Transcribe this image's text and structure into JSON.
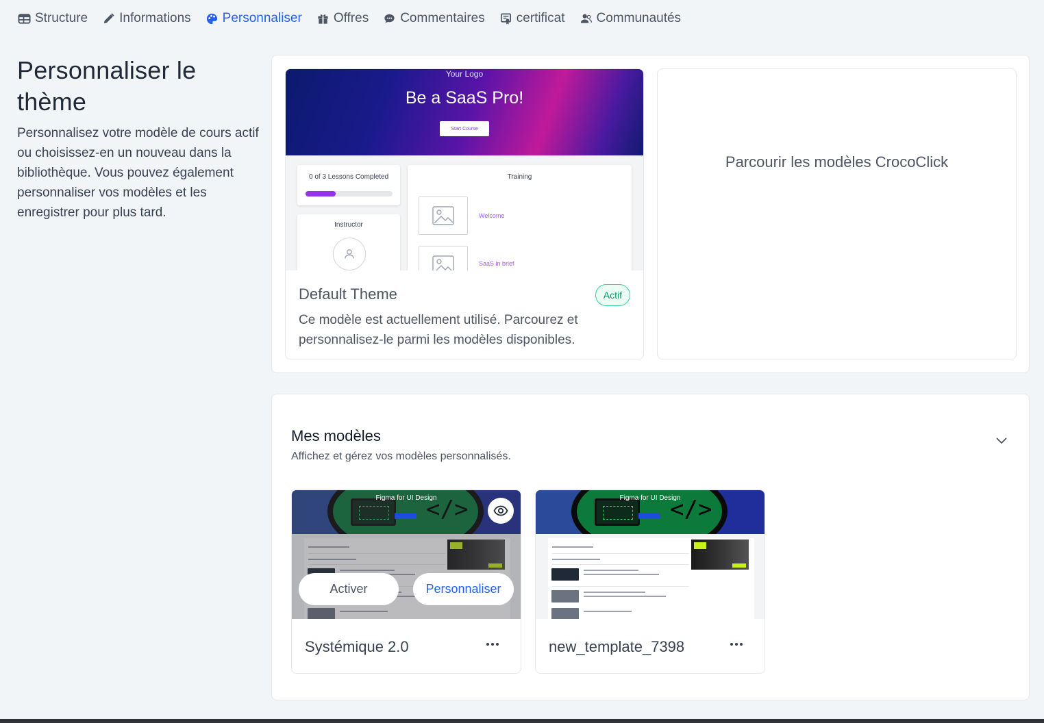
{
  "tabs": [
    {
      "label": "Structure",
      "icon": "table-icon",
      "active": false
    },
    {
      "label": "Informations",
      "icon": "pencil-icon",
      "active": false
    },
    {
      "label": "Personnaliser",
      "icon": "palette-icon",
      "active": true
    },
    {
      "label": "Offres",
      "icon": "gift-icon",
      "active": false
    },
    {
      "label": "Commentaires",
      "icon": "comment-icon",
      "active": false
    },
    {
      "label": "certificat",
      "icon": "certificate-icon",
      "active": false
    },
    {
      "label": "Communautés",
      "icon": "users-icon",
      "active": false
    }
  ],
  "intro": {
    "title": "Personnaliser le thème",
    "description": "Personnalisez votre modèle de cours actif ou choisissez-en un nouveau dans la bibliothèque. Vous pouvez également personnaliser vos modèles et les enregistrer pour plus tard."
  },
  "active_theme": {
    "preview": {
      "logo": "Your Logo",
      "headline": "Be a SaaS Pro!",
      "button": "Start Course",
      "progress_text": "0 of 3 Lessons Completed",
      "progress": 0.35,
      "instructor": "Instructor",
      "training": "Training",
      "lesson_1": "Welcome",
      "lesson_2": "SaaS in brief"
    },
    "name": "Default Theme",
    "badge": "Actif",
    "description": "Ce modèle est actuellement utilisé. Parcourez et personnalisez-le parmi les modèles disponibles."
  },
  "browse": {
    "label": "Parcourir les modèles CrocoClick"
  },
  "my_templates": {
    "title": "Mes modèles",
    "subtitle": "Affichez et gérez vos modèles personnalisés.",
    "preview_title": "Figma for UI Design",
    "activate_label": "Activer",
    "customize_label": "Personnaliser",
    "items": [
      {
        "name": "Systémique 2.0"
      },
      {
        "name": "new_template_7398"
      }
    ]
  },
  "colors": {
    "accent": "#2563eb",
    "active_badge": "#059669",
    "progress": "#9333ea"
  }
}
